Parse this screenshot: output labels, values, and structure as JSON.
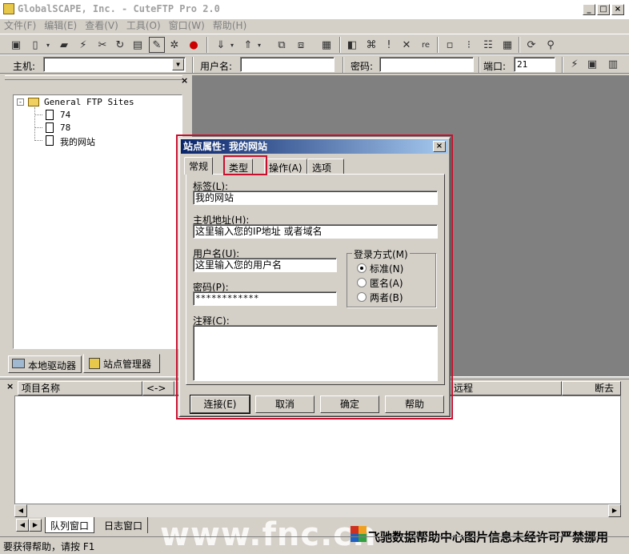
{
  "window": {
    "title": "GlobalSCAPE, Inc. - CuteFTP Pro 2.0",
    "min": "_",
    "max": "□",
    "close": "×"
  },
  "menu": [
    "文件(F)",
    "编辑(E)",
    "查看(V)",
    "工具(O)",
    "窗口(W)",
    "帮助(H)"
  ],
  "connbar": {
    "host_label": "主机:",
    "host_value": "",
    "user_label": "用户名:",
    "user_value": "",
    "pass_label": "密码:",
    "pass_value": "",
    "port_label": "端口:",
    "port_value": "21"
  },
  "tree": {
    "root": "General FTP Sites",
    "items": [
      "74",
      "78",
      "我的网站"
    ]
  },
  "left_tabs": [
    "本地驱动器",
    "站点管理器"
  ],
  "queue": {
    "columns": [
      "项目名称",
      "<->",
      "远程",
      "断去"
    ]
  },
  "bottom_tabs": [
    "队列窗口",
    "日志窗口"
  ],
  "status": "要获得帮助，请按 F1",
  "watermark": {
    "url": "www.fnc.cn",
    "text": "飞驰数据帮助中心图片信息未经许可严禁挪用"
  },
  "dialog": {
    "title": "站点属性: 我的网站",
    "tabs": [
      "常规",
      "类型",
      "操作(A)",
      "选项"
    ],
    "label_label": "标签(L):",
    "label_value": "我的网站",
    "host_label": "主机地址(H):",
    "host_value": "这里输入您的IP地址 或者域名",
    "user_label": "用户名(U):",
    "user_value": "这里输入您的用户名",
    "pass_label": "密码(P):",
    "pass_value": "************",
    "login_group": "登录方式(M)",
    "login_options": [
      "标准(N)",
      "匿名(A)",
      "两者(B)"
    ],
    "login_selected": 0,
    "comment_label": "注释(C):",
    "comment_value": "",
    "buttons": [
      "连接(E)",
      "取消",
      "确定",
      "帮助"
    ]
  }
}
